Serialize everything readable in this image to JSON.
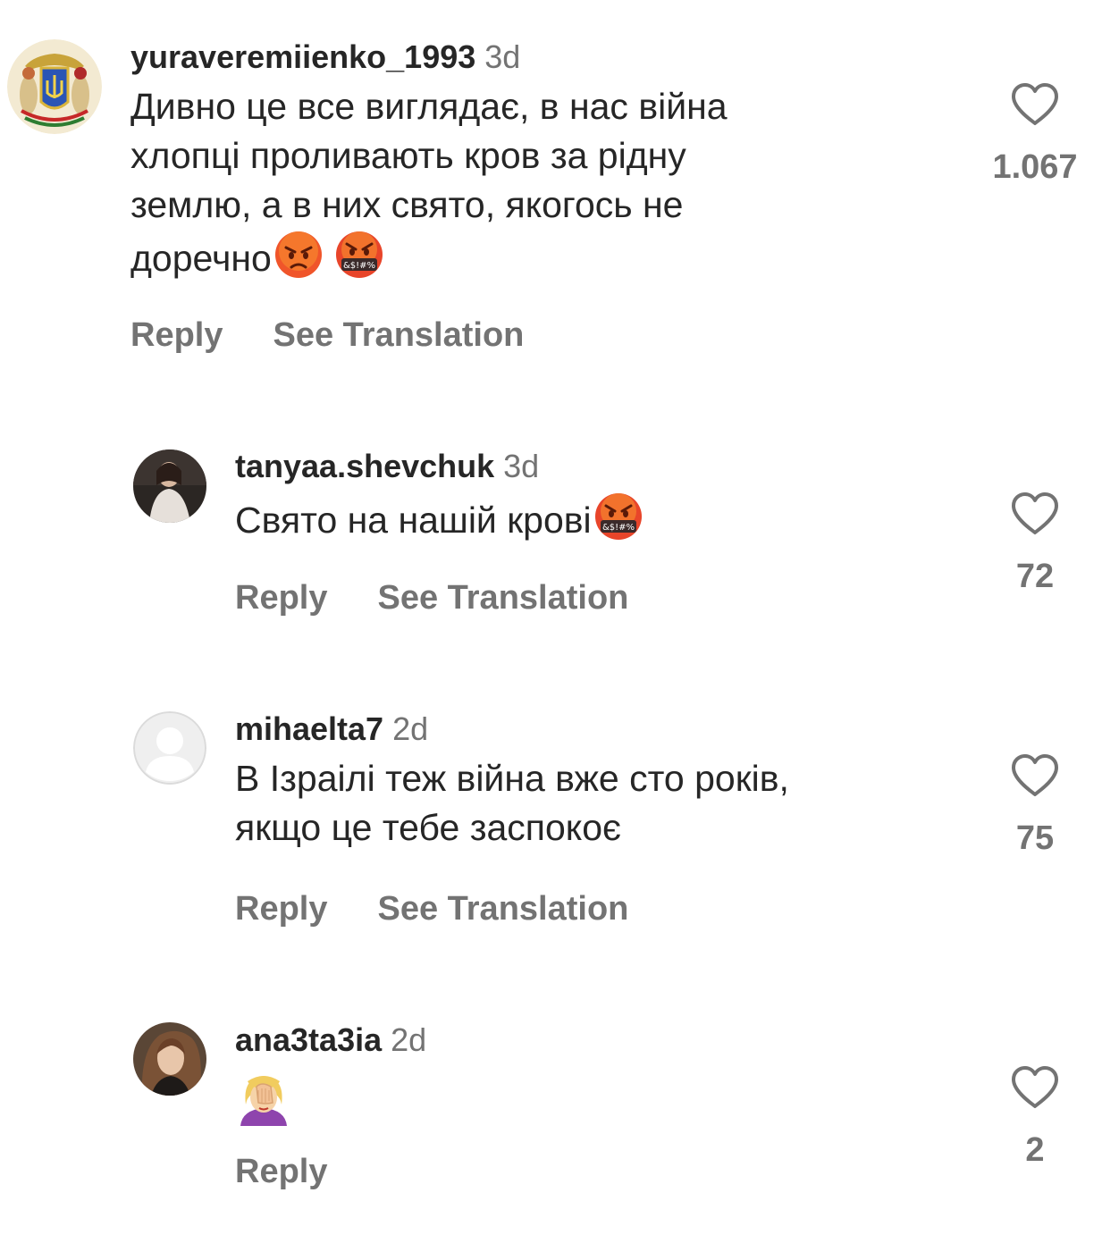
{
  "comments": [
    {
      "username": "yuraveremiienko_1993",
      "time": "3d",
      "lines": [
        "Дивно це все виглядає, в нас війна",
        "хлопці проливають кров за рідну",
        "землю, а в них свято, якогось не",
        "доречно"
      ],
      "emojis": [
        "enraged-face-emoji",
        "face-with-symbols-on-mouth-emoji"
      ],
      "likes": "1.067",
      "actions": {
        "reply": "Reply",
        "translate": "See Translation"
      },
      "avatar": "ukraine-coat-of-arms"
    },
    {
      "username": "tanyaa.shevchuk",
      "time": "3d",
      "lines": [
        "Свято на нашій крові"
      ],
      "emojis": [
        "face-with-symbols-on-mouth-emoji"
      ],
      "likes": "72",
      "actions": {
        "reply": "Reply",
        "translate": "See Translation"
      },
      "avatar": "user-photo"
    },
    {
      "username": "mihaelta7",
      "time": "2d",
      "lines": [
        "В Ізраілі теж війна вже сто років,",
        "якщо це тебе заспокоє"
      ],
      "emojis": [],
      "likes": "75",
      "actions": {
        "reply": "Reply",
        "translate": "See Translation"
      },
      "avatar": "default-avatar"
    },
    {
      "username": "ana3ta3ia",
      "time": "2d",
      "lines": [],
      "emojis": [
        "face-palm-emoji"
      ],
      "likes": "2",
      "actions": {
        "reply": "Reply"
      },
      "avatar": "user-photo"
    }
  ],
  "colors": {
    "text": "#262626",
    "secondary": "#737373",
    "background": "#ffffff"
  }
}
